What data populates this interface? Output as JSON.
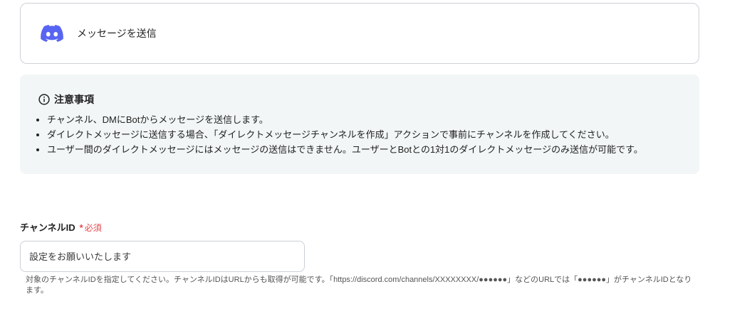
{
  "action_card": {
    "icon": "discord-icon",
    "title": "メッセージを送信"
  },
  "notice": {
    "icon": "info-icon",
    "title": "注意事項",
    "items": [
      "チャンネル、DMにBotからメッセージを送信します。",
      "ダイレクトメッセージに送信する場合、「ダイレクトメッセージチャンネルを作成」アクションで事前にチャンネルを作成してください。",
      "ユーザー間のダイレクトメッセージにはメッセージの送信はできません。ユーザーとBotとの1対1のダイレクトメッセージのみ送信が可能です。"
    ]
  },
  "channel_id_field": {
    "label": "チャンネルID",
    "required_mark": "*",
    "required_label": "必須",
    "value": "",
    "placeholder": "設定をお願いいたします",
    "help_text": "対象のチャンネルIDを指定してください。チャンネルIDはURLからも取得が可能です。「https://discord.com/channels/XXXXXXXX/●●●●●●」などのURLでは「●●●●●●」がチャンネルIDとなります。"
  },
  "colors": {
    "discord": "#5865F2",
    "required": "#E5484D",
    "notice_bg": "#F2F6F6"
  }
}
